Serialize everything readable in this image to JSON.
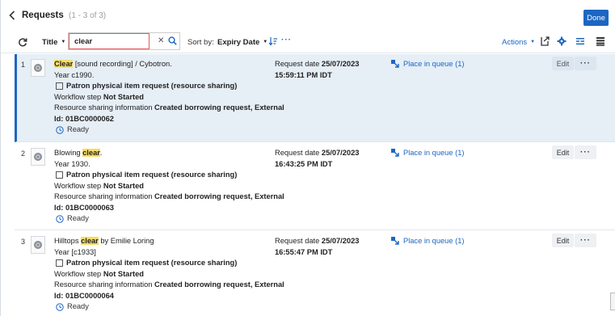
{
  "header": {
    "title": "Requests",
    "count": "(1 - 3 of 3)",
    "done_label": "Done"
  },
  "toolbar": {
    "field_select": "Title",
    "search_value": "clear",
    "sort_label": "Sort by:",
    "sort_value": "Expiry Date",
    "more_label": "···",
    "actions_label": "Actions"
  },
  "rows": [
    {
      "num": "1",
      "title_hl": "Clear",
      "title_rest": " [sound recording] / Cybotron.",
      "year_label": "Year",
      "year": "c1990.",
      "request_type": "Patron physical item request (resource sharing)",
      "workflow_label": "Workflow step",
      "workflow": "Not Started",
      "rs_label": "Resource sharing information",
      "rs_value": "Created borrowing request, External",
      "id_label": "Id:",
      "id": "01BC0000062",
      "status": "Ready",
      "request_date_label": "Request date",
      "request_date": "25/07/2023",
      "request_time": "15:59:11 PM IDT",
      "queue": "Place in queue (1)",
      "edit_label": "Edit",
      "more_label": "···"
    },
    {
      "num": "2",
      "title_pre": "Blowing ",
      "title_hl": "clear",
      "title_rest": ".",
      "year_label": "Year",
      "year": "1930.",
      "request_type": "Patron physical item request (resource sharing)",
      "workflow_label": "Workflow step",
      "workflow": "Not Started",
      "rs_label": "Resource sharing information",
      "rs_value": "Created borrowing request, External",
      "id_label": "Id:",
      "id": "01BC0000063",
      "status": "Ready",
      "request_date_label": "Request date",
      "request_date": "25/07/2023",
      "request_time": "16:43:25 PM IDT",
      "queue": "Place in queue (1)",
      "edit_label": "Edit",
      "more_label": "···"
    },
    {
      "num": "3",
      "title_pre": "Hilltops ",
      "title_hl": "clear",
      "title_rest": " by Emilie Loring",
      "year_label": "Year",
      "year": "[c1933]",
      "request_type": "Patron physical item request (resource sharing)",
      "workflow_label": "Workflow step",
      "workflow": "Not Started",
      "rs_label": "Resource sharing information",
      "rs_value": "Created borrowing request, External",
      "id_label": "Id:",
      "id": "01BC0000064",
      "status": "Ready",
      "request_date_label": "Request date",
      "request_date": "25/07/2023",
      "request_time": "16:55:47 PM IDT",
      "queue": "Place in queue (1)",
      "edit_label": "Edit",
      "more_label": "···"
    }
  ],
  "icons": {
    "back": "chevron-left-icon",
    "refresh": "refresh-icon",
    "search": "search-icon",
    "sort_direction": "sort-direction-icon",
    "export": "export-icon",
    "settings": "gear-icon",
    "filter_view": "filter-columns-icon",
    "list_view": "list-view-icon",
    "queue": "queue-icon",
    "status": "clock-icon",
    "item": "item-thumbnail-icon"
  },
  "colors": {
    "accent": "#1c66c2",
    "selected_row": "#e6eef6",
    "highlight": "#f5dd66",
    "search_border": "#e05a5a"
  }
}
